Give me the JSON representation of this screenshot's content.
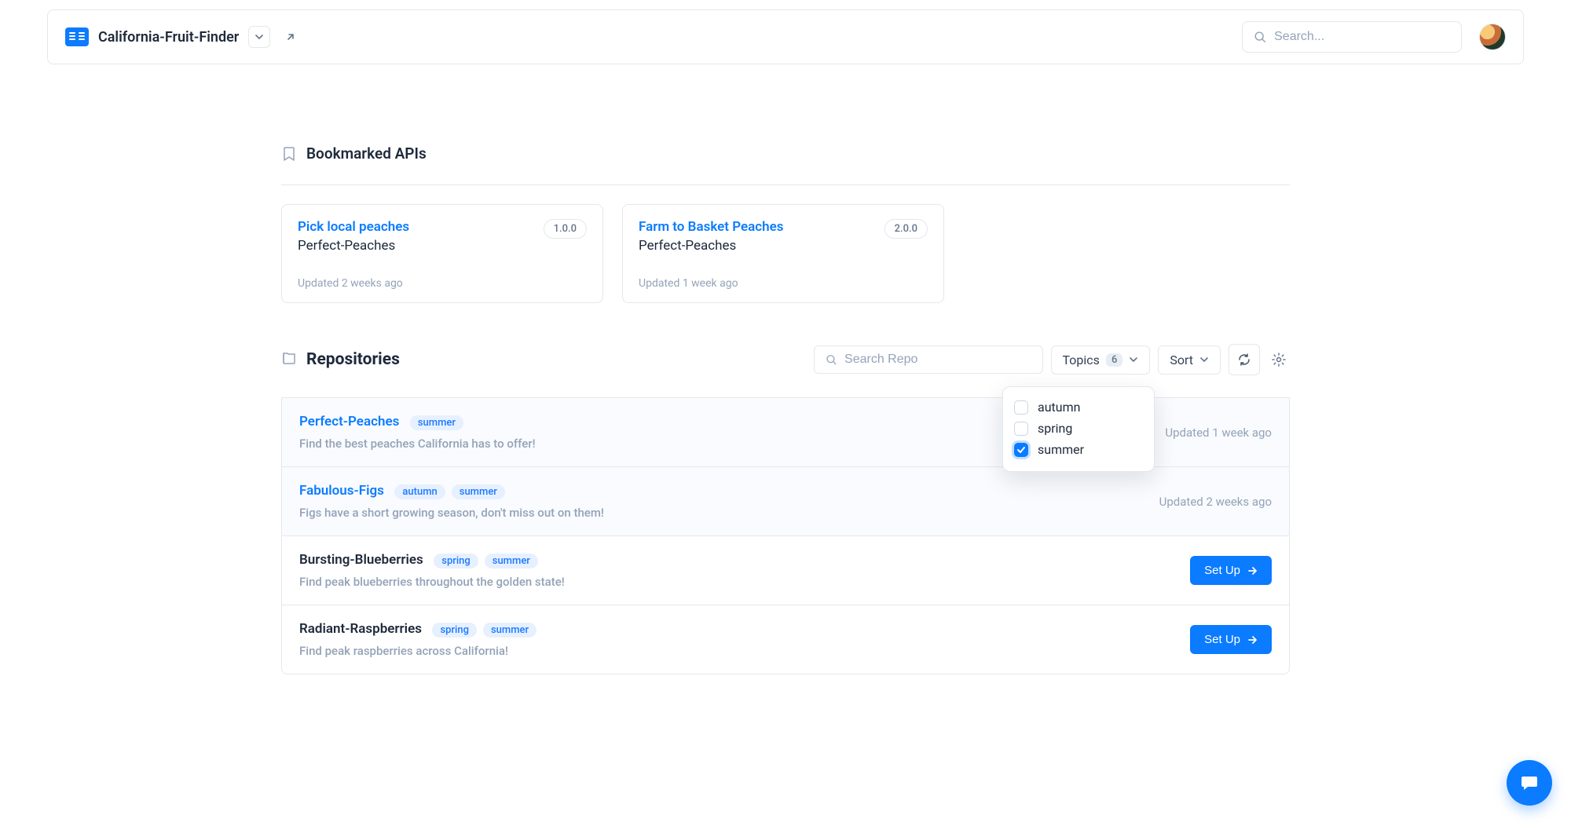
{
  "header": {
    "project_name": "California-Fruit-Finder",
    "search_placeholder": "Search..."
  },
  "bookmarked": {
    "title": "Bookmarked APIs",
    "cards": [
      {
        "name": "Pick local peaches",
        "subtitle": "Perfect-Peaches",
        "version": "1.0.0",
        "updated": "Updated 2 weeks ago"
      },
      {
        "name": "Farm to Basket Peaches",
        "subtitle": "Perfect-Peaches",
        "version": "2.0.0",
        "updated": "Updated 1 week ago"
      }
    ]
  },
  "repositories": {
    "title": "Repositories",
    "search_placeholder": "Search Repo",
    "topics_label": "Topics",
    "topics_count": "6",
    "sort_label": "Sort",
    "dropdown": [
      {
        "label": "autumn",
        "checked": false
      },
      {
        "label": "spring",
        "checked": false
      },
      {
        "label": "summer",
        "checked": true
      }
    ],
    "items": [
      {
        "name": "Perfect-Peaches",
        "tags": [
          "summer"
        ],
        "desc": "Find the best peaches California has to offer!",
        "updated": "Updated 1 week ago",
        "linked": true,
        "setup": false
      },
      {
        "name": "Fabulous-Figs",
        "tags": [
          "autumn",
          "summer"
        ],
        "desc": "Figs have a short growing season, don't miss out on them!",
        "updated": "Updated 2 weeks ago",
        "linked": true,
        "setup": false
      },
      {
        "name": "Bursting-Blueberries",
        "tags": [
          "spring",
          "summer"
        ],
        "desc": "Find peak blueberries throughout the golden state!",
        "updated": "",
        "linked": false,
        "setup": true
      },
      {
        "name": "Radiant-Raspberries",
        "tags": [
          "spring",
          "summer"
        ],
        "desc": "Find peak raspberries across California!",
        "updated": "",
        "linked": false,
        "setup": true
      }
    ],
    "setup_label": "Set Up"
  }
}
